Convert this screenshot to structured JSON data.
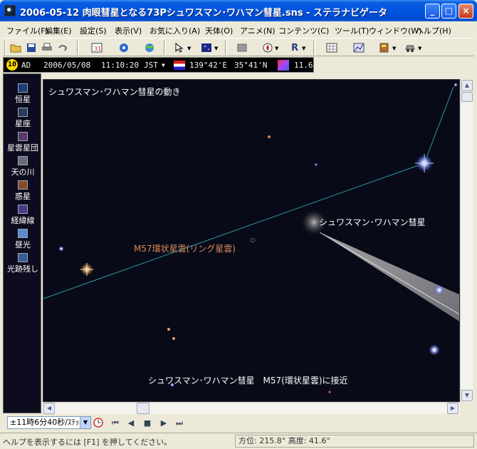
{
  "window": {
    "title": "2006-05-12 肉眼彗星となる73Pシュワスマン･ワハマン彗星.sns - ステラナビゲータ",
    "min_label": "_",
    "max_label": "□",
    "close_label": "×"
  },
  "menu": [
    "ファイル(F)",
    "編集(E)",
    "設定(S)",
    "表示(V)",
    "お気に入り(A)",
    "天体(O)",
    "アニメ(N)",
    "コンテンツ(C)",
    "ツール(T)",
    "ウィンドウ(W)",
    "ヘルプ(H)"
  ],
  "toolbar": {
    "icons": [
      "open-folder-icon",
      "save-icon",
      "print-icon",
      "undo-icon",
      "calendar-icon",
      "observer-icon",
      "globe-icon",
      "pointer-icon",
      "screen-icon",
      "stop-icon",
      "compass-icon",
      "r-icon",
      "grid-icon",
      "chart-icon",
      "book-icon",
      "car-icon"
    ],
    "r_label": "R"
  },
  "infobar": {
    "ad_badge": "10",
    "era": "AD",
    "date": "2006/05/08",
    "time": "11:10:20",
    "tz": "JST",
    "longitude": "139°42'E",
    "latitude": "35°41'N",
    "limiting_mag": "11.6"
  },
  "sidebar": [
    {
      "label": "恒星",
      "icon": "star-icon"
    },
    {
      "label": "星座",
      "icon": "constellation-icon"
    },
    {
      "label": "星雲星団",
      "icon": "nebula-icon"
    },
    {
      "label": "天の川",
      "icon": "milky-way-icon"
    },
    {
      "label": "惑星",
      "icon": "planet-icon"
    },
    {
      "label": "経緯線",
      "icon": "grid-lines-icon"
    },
    {
      "label": "昼光",
      "icon": "daylight-icon"
    },
    {
      "label": "光跡残し",
      "icon": "trail-icon"
    }
  ],
  "sky": {
    "panel_title": "シュワスマン･ワハマン彗星の動き",
    "comet_label": "シュワスマン･ワハマン彗星",
    "nebula_label": "M57環状星雲(リング星雲)",
    "caption": "シュワスマン･ワハマン彗星　M57(環状星雲)に接近",
    "line_color": "#2a9aa8",
    "nebula_label_color": "#d88a5a"
  },
  "timebar": {
    "step": "±11時6分40秒/ｽﾃｯﾌﾟ",
    "controls": [
      "⏮",
      "◀",
      "■",
      "▶",
      "⏭"
    ]
  },
  "status": {
    "help_text": "ヘルプを表示するには [F1] を押してください。",
    "azimuth": "方位: 215.8°  高度:  41.6°"
  }
}
